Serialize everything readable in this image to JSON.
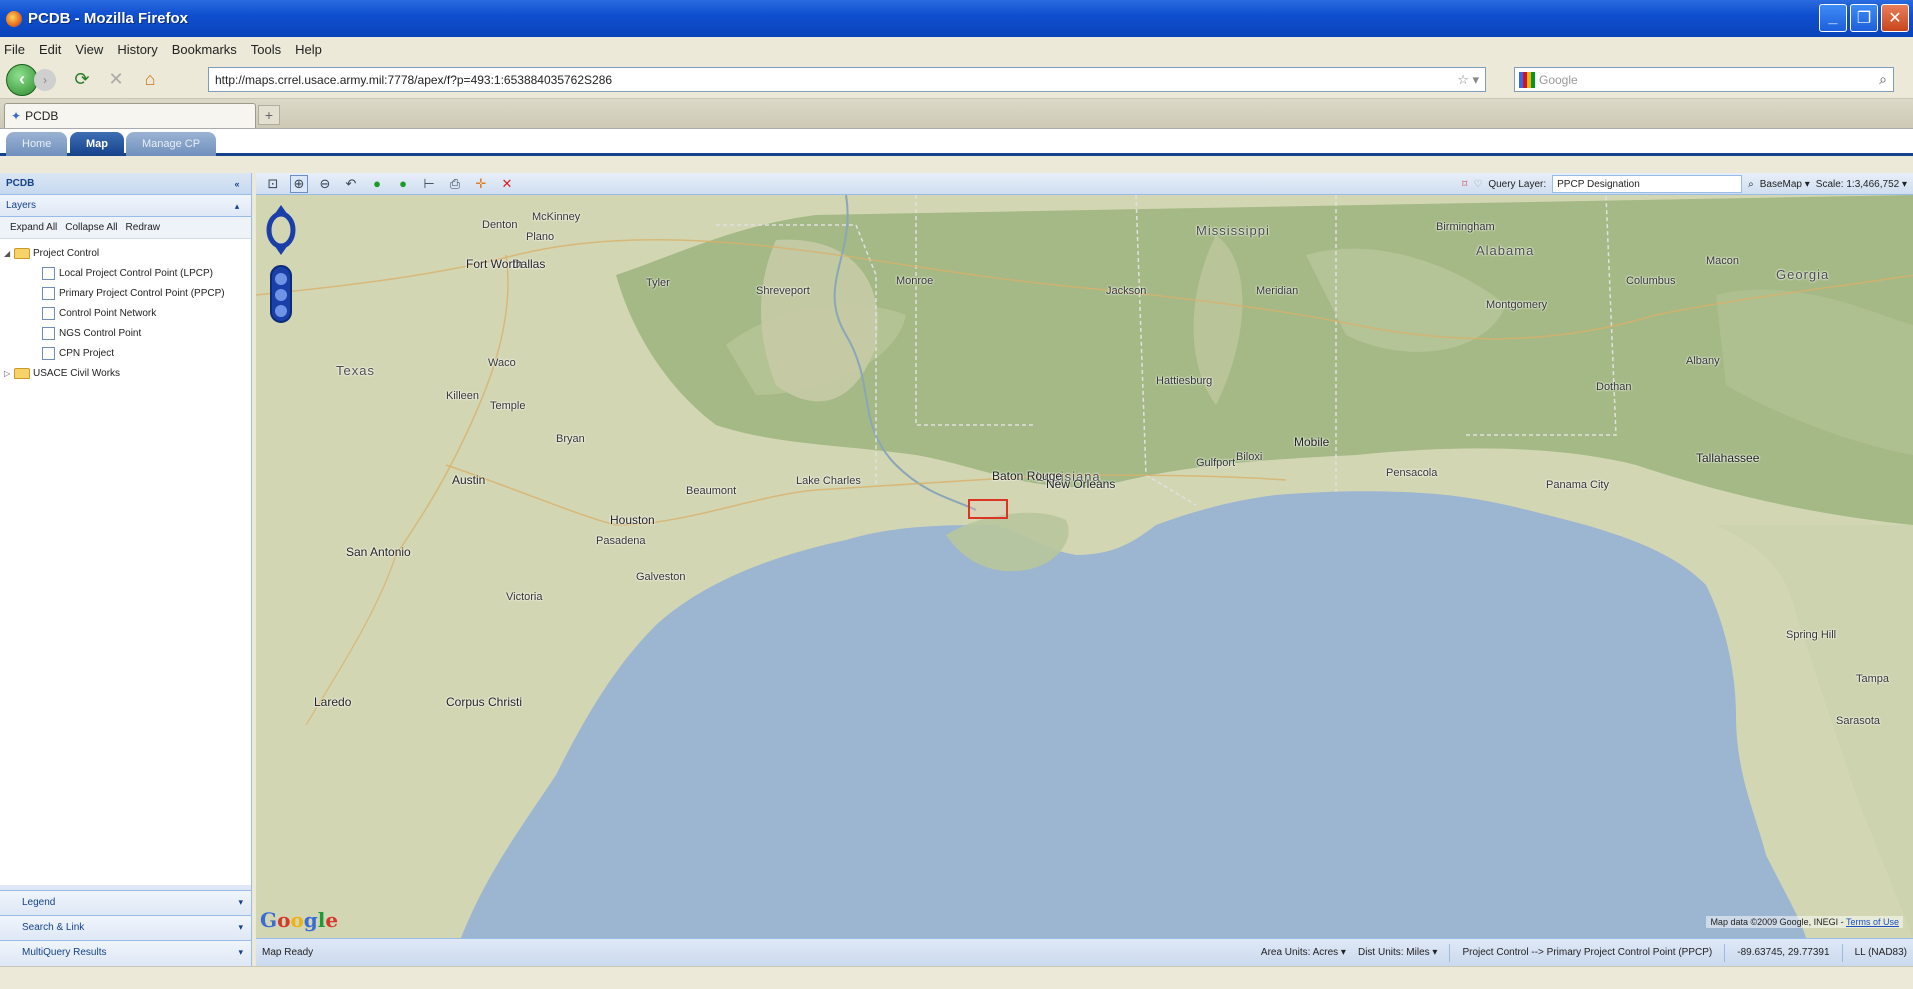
{
  "window": {
    "title": "PCDB - Mozilla Firefox"
  },
  "menu": [
    "File",
    "Edit",
    "View",
    "History",
    "Bookmarks",
    "Tools",
    "Help"
  ],
  "nav": {
    "url": "http://maps.crrel.usace.army.mil:7778/apex/f?p=493:1:653884035762S286",
    "search_placeholder": "Google"
  },
  "browser_tab": {
    "label": "PCDB"
  },
  "app_tabs": [
    "Home",
    "Map",
    "Manage CP"
  ],
  "left_panel": {
    "title": "PCDB",
    "layers_title": "Layers",
    "tools": [
      "Expand All",
      "Collapse All",
      "Redraw"
    ],
    "tree": {
      "folder1": "Project Control",
      "items": [
        "Local Project Control Point (LPCP)",
        "Primary Project Control Point (PPCP)",
        "Control Point Network",
        "NGS Control Point",
        "CPN Project"
      ],
      "folder2": "USACE Civil Works"
    },
    "bottom": [
      "Legend",
      "Search & Link",
      "MultiQuery Results"
    ]
  },
  "map_toolbar": {
    "query_layer_label": "Query Layer:",
    "query_layer_value": "PPCP Designation",
    "basemap_label": "BaseMap ▾",
    "scale": "Scale: 1:3,466,752 ▾"
  },
  "map": {
    "states": [
      "Texas",
      "Louisiana",
      "Mississippi",
      "Alabama",
      "Georgia"
    ],
    "cities": {
      "dallas": "Dallas",
      "fortworth": "Fort Worth",
      "plano": "Plano",
      "waco": "Waco",
      "austin": "Austin",
      "sanantonio": "San Antonio",
      "houston": "Houston",
      "pasadena": "Pasadena",
      "beaumont": "Beaumont",
      "batonrouge": "Baton Rouge",
      "neworleans": "New Orleans",
      "mobile": "Mobile",
      "pensacola": "Pensacola",
      "tallahassee": "Tallahassee",
      "jackson": "Jackson",
      "montgomery": "Montgomery",
      "birmingham": "Birmingham",
      "shreveport": "Shreveport",
      "corpus": "Corpus Christi",
      "laredo": "Laredo",
      "victoria": "Victoria",
      "bryan": "Bryan",
      "temple": "Temple",
      "killeen": "Killeen",
      "galveston": "Galveston",
      "lakecharles": "Lake Charles",
      "biloxi": "Biloxi",
      "gulfport": "Gulfport",
      "hattiesburg": "Hattiesburg",
      "albany": "Albany",
      "dothan": "Dothan",
      "panama": "Panama City",
      "tampa": "Tampa",
      "sarasota": "Sarasota",
      "springhill": "Spring Hill",
      "denton": "Denton",
      "mckinney": "McKinney",
      "tyler": "Tyler",
      "monroe": "Monroe",
      "meridian": "Meridian",
      "columbus": "Columbus",
      "macon": "Macon"
    },
    "attribution": "Map data ©2009 Google, INEGI -",
    "terms": "Terms of Use"
  },
  "status": {
    "left": "Map Ready",
    "area_units": "Area Units: Acres ▾",
    "dist_units": "Dist Units: Miles ▾",
    "layer": "Project Control --> Primary Project Control Point (PPCP)",
    "coords": "-89.63745, 29.77391",
    "datum": "LL (NAD83)"
  },
  "colors": {
    "accent": "#15428b",
    "water": "#99b3cc",
    "land": "#cfd6b4",
    "forest": "#9fb57f",
    "titlebar": "#0a43b8"
  }
}
